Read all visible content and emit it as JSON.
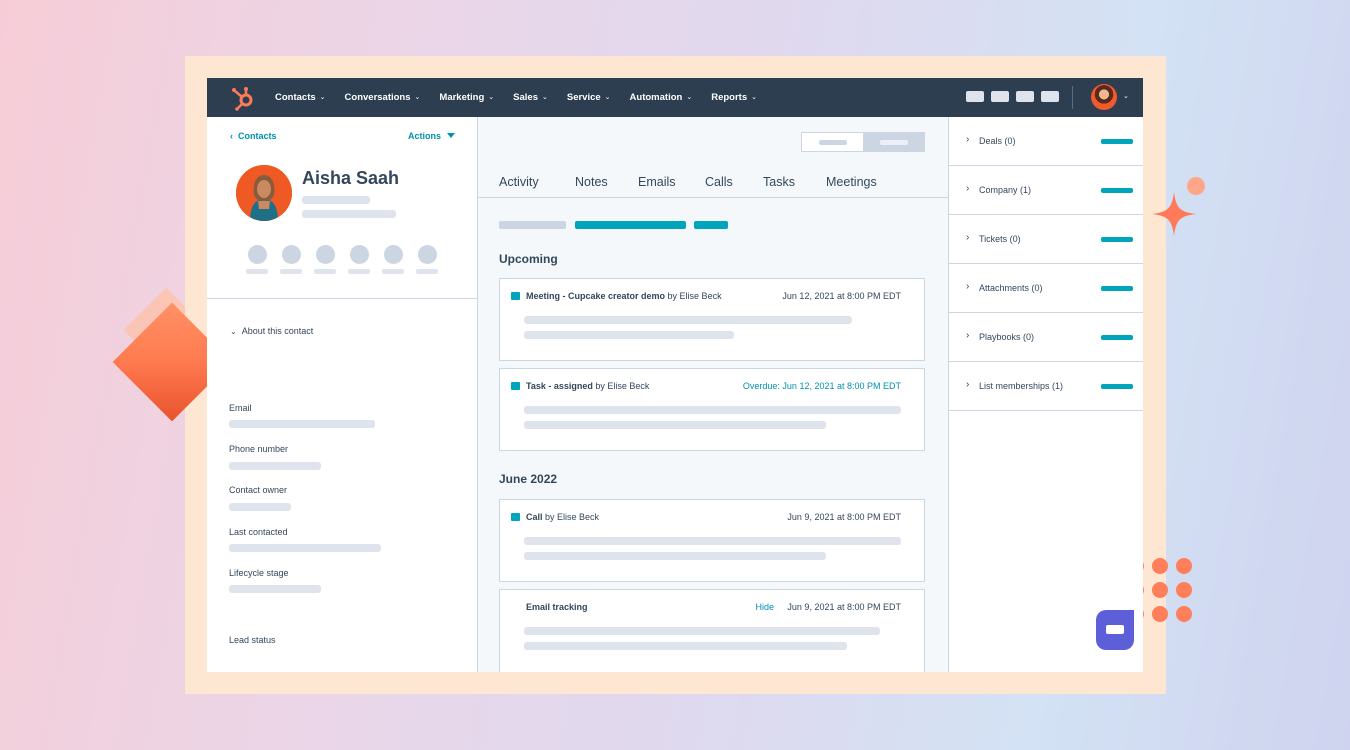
{
  "nav": {
    "items": [
      "Contacts",
      "Conversations",
      "Marketing",
      "Sales",
      "Service",
      "Automation",
      "Reports"
    ],
    "chevron": "⌄"
  },
  "contact": {
    "back_label": "Contacts",
    "actions_label": "Actions",
    "name": "Aisha Saah"
  },
  "about": {
    "title": "About this contact",
    "fields": [
      "Email",
      "Phone number",
      "Contact owner",
      "Last contacted",
      "Lifecycle stage",
      "Lead status"
    ]
  },
  "tabs": [
    "Activity",
    "Notes",
    "Emails",
    "Calls",
    "Tasks",
    "Meetings"
  ],
  "timeline": {
    "upcoming_title": "Upcoming",
    "june_title": "June 2022",
    "meeting": {
      "prefix": "Meeting - Cupcake creator demo",
      "by": " by Elise Beck",
      "date": "Jun 12, 2021 at 8:00 PM EDT"
    },
    "task": {
      "prefix": "Task - assigned",
      "by": " by Elise Beck",
      "date": "Overdue: Jun 12, 2021 at 8:00 PM EDT"
    },
    "call": {
      "prefix": "Call",
      "by": " by Elise Beck",
      "date": "Jun 9, 2021 at 8:00 PM EDT"
    },
    "email": {
      "title": "Email tracking",
      "hide": "Hide",
      "date": "Jun 9, 2021 at 8:00 PM EDT"
    }
  },
  "sidebar": {
    "items": [
      "Deals (0)",
      "Company (1)",
      "Tickets (0)",
      "Attachments (0)",
      "Playbooks (0)",
      "List memberships (1)"
    ]
  },
  "colors": {
    "nav_bg": "#2d3e50",
    "accent_teal": "#00a4bd",
    "link": "#0091ae",
    "brand_orange": "#ff7a59",
    "placeholder": "#dfe3eb"
  },
  "icons": {
    "logo": "hubspot-sprocket-icon",
    "chevron": "chevron-down-icon",
    "expand": "chevron-right-icon"
  }
}
